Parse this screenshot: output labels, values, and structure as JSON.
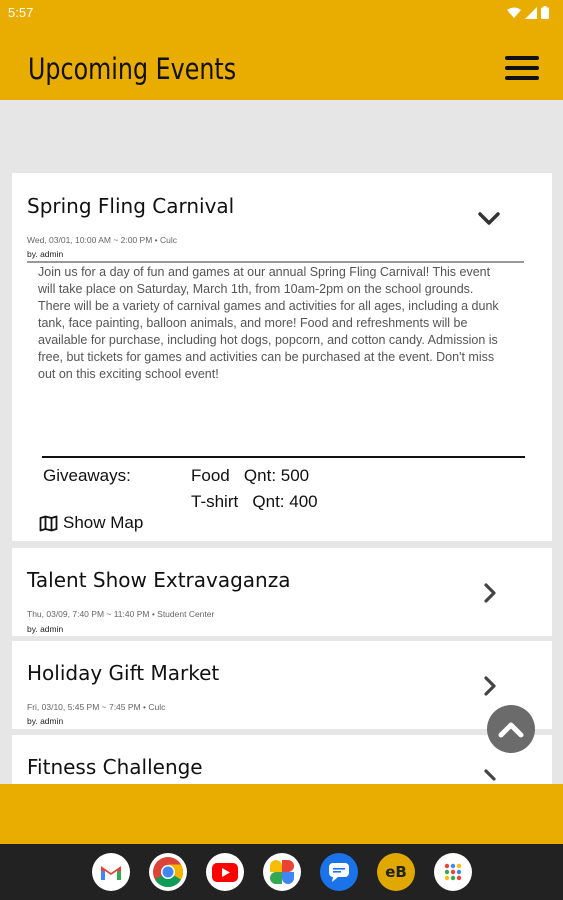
{
  "status": {
    "time": "5:57"
  },
  "header": {
    "title": "Upcoming Events"
  },
  "events": [
    {
      "title": "Spring Fling Carnival",
      "meta": "Wed, 03/01, 10:00 AM ~ 2:00 PM • Culc",
      "by": "by. admin",
      "description": "Join us for a day of fun and games at our annual Spring Fling Carnival! This event will take place on Saturday, March 1th, from 10am-2pm on the school grounds. There will be a variety of carnival games and activities for all ages, including a dunk tank, face painting, balloon animals, and more! Food and refreshments will be available for purchase, including hot dogs, popcorn, and cotton candy. Admission is free, but tickets for games and activities can be purchased at the event. Don't miss out on this exciting school event!",
      "giveaways_label": "Giveaways:",
      "giveaways": [
        {
          "item": "Food",
          "qty": "Qnt: 500"
        },
        {
          "item": "T-shirt",
          "qty": "Qnt: 400"
        }
      ],
      "show_map": "Show Map"
    },
    {
      "title": "Talent Show Extravaganza",
      "meta": "Thu, 03/09, 7:40 PM ~ 11:40 PM • Student Center",
      "by": "by. admin"
    },
    {
      "title": "Holiday Gift Market",
      "meta": "Fri, 03/10, 5:45 PM ~ 7:45 PM • Culc",
      "by": "by. admin"
    },
    {
      "title": "Fitness Challenge"
    }
  ],
  "icons": {
    "menu": "menu-icon",
    "expand": "chevron-down-icon",
    "open": "chevron-right-icon",
    "map": "map-icon",
    "scroll_top": "chevron-up-icon"
  },
  "dock_apps": [
    "gmail",
    "chrome",
    "youtube",
    "photos",
    "messages",
    "eB",
    "apps"
  ],
  "dock": {
    "eb_label": "eB"
  },
  "colors": {
    "accent": "#e9ac00",
    "fab": "#6b6b6b"
  }
}
